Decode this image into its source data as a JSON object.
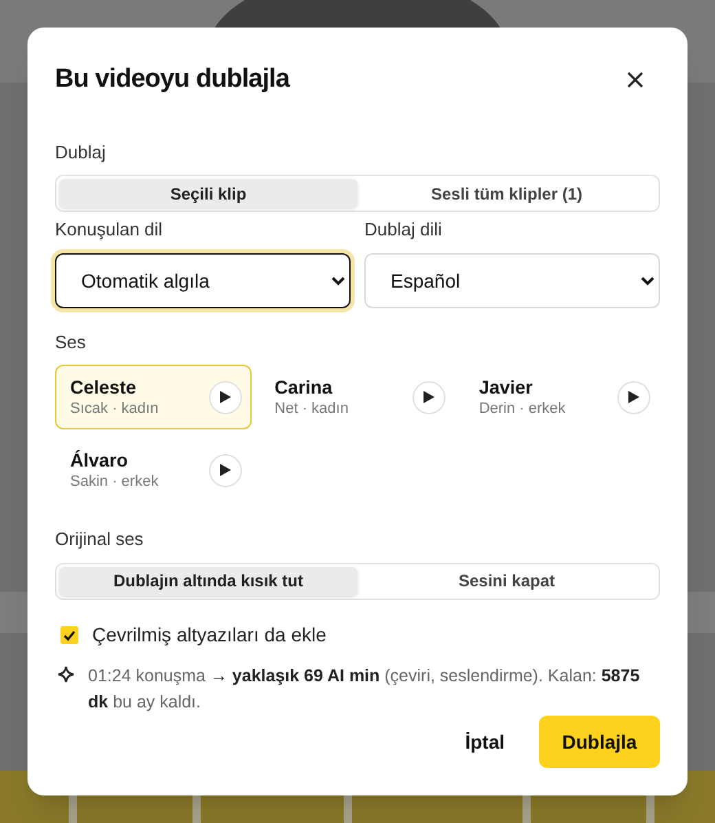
{
  "dialog": {
    "title": "Bu videoyu dublajla"
  },
  "dub_scope": {
    "label": "Dublaj",
    "options": [
      {
        "label": "Seçili klip",
        "selected": true
      },
      {
        "label": "Sesli tüm klipler (1)",
        "selected": false
      }
    ]
  },
  "spoken_language": {
    "label": "Konuşulan dil",
    "value": "Otomatik algıla",
    "focused": true
  },
  "dub_language": {
    "label": "Dublaj dili",
    "value": "Español",
    "focused": false
  },
  "voices": {
    "label": "Ses",
    "items": [
      {
        "name": "Celeste",
        "description": "Sıcak · kadın",
        "selected": true
      },
      {
        "name": "Carina",
        "description": "Net · kadın",
        "selected": false
      },
      {
        "name": "Javier",
        "description": "Derin · erkek",
        "selected": false
      },
      {
        "name": "Álvaro",
        "description": "Sakin · erkek",
        "selected": false
      }
    ]
  },
  "original_audio": {
    "label": "Orijinal ses",
    "options": [
      {
        "label": "Dublajın altında kısık tut",
        "selected": true
      },
      {
        "label": "Sesini kapat",
        "selected": false
      }
    ]
  },
  "subtitles": {
    "label": "Çevrilmiş altyazıları da ekle",
    "checked": true
  },
  "info": {
    "text": "01:24 konuşma **→ yaklaşık 69 AI min** (çeviri, seslendirme). Kalan: **5875 dk** bu ay kaldı."
  },
  "buttons": {
    "cancel": "İptal",
    "confirm": "Dublajla"
  }
}
